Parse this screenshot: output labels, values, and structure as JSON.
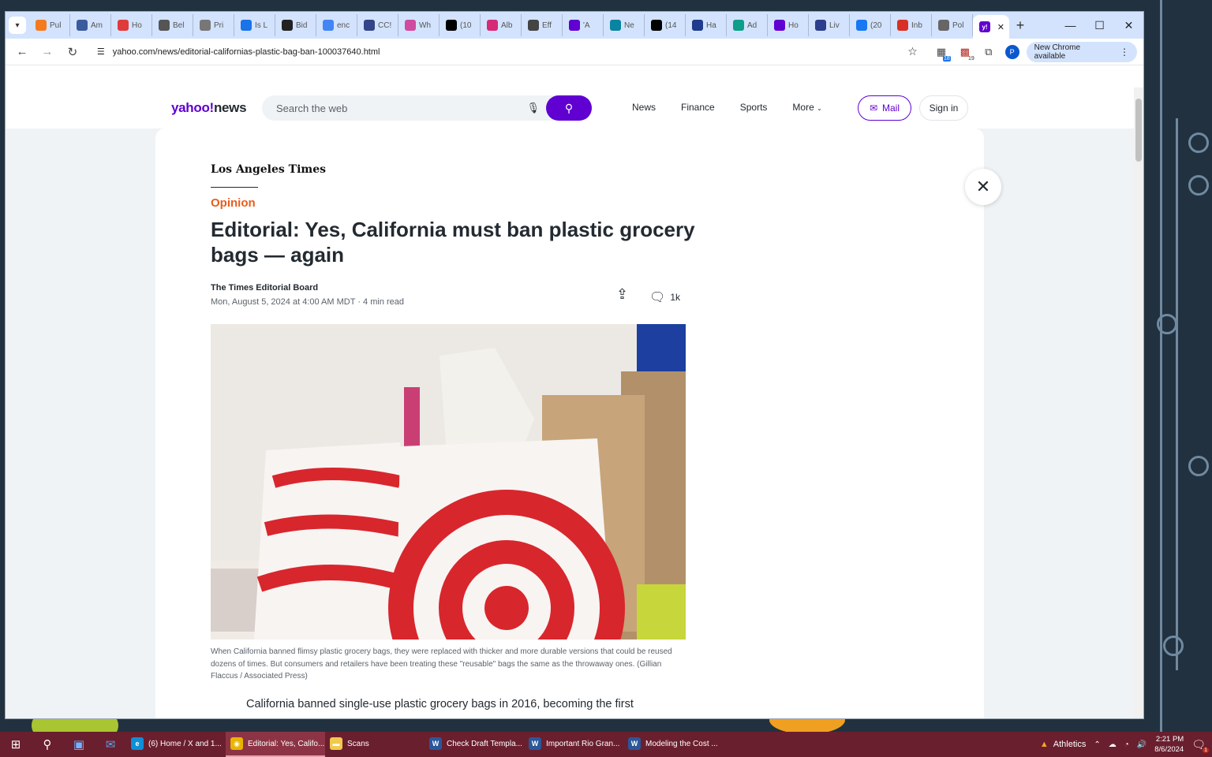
{
  "browser": {
    "tabs": [
      {
        "label": "Pul",
        "icon": "puzzle-orange-icon",
        "color": "#f47a20"
      },
      {
        "label": "Am",
        "icon": "globe-icon",
        "color": "#3a5b9c"
      },
      {
        "label": "Ho",
        "icon": "pen-icon",
        "color": "#e03a3a"
      },
      {
        "label": "Bel",
        "icon": "seal-icon",
        "color": "#555555"
      },
      {
        "label": "Pri",
        "icon": "seal-icon",
        "color": "#777777"
      },
      {
        "label": "Is L",
        "icon": "b-icon",
        "color": "#1a73e8"
      },
      {
        "label": "Bid",
        "icon": "diamond-icon",
        "color": "#222222"
      },
      {
        "label": "enc",
        "icon": "google-icon",
        "color": "#4285f4"
      },
      {
        "label": "CC!",
        "icon": "seal-icon",
        "color": "#334488"
      },
      {
        "label": "Wh",
        "icon": "wave-icon",
        "color": "#d04aa0"
      },
      {
        "label": "(10",
        "icon": "x-icon",
        "color": "#000000"
      },
      {
        "label": "Alb",
        "icon": "instagram-icon",
        "color": "#d62976"
      },
      {
        "label": "Eff",
        "icon": "seal-icon",
        "color": "#444444"
      },
      {
        "label": "'A",
        "icon": "yahoo-icon",
        "color": "#6001d2"
      },
      {
        "label": "Ne",
        "icon": "globe-icon",
        "color": "#0a84a0"
      },
      {
        "label": "(14",
        "icon": "x-icon",
        "color": "#000000"
      },
      {
        "label": "Ha",
        "icon": "h-icon",
        "color": "#1f3b8c"
      },
      {
        "label": "Ad",
        "icon": "r-icon",
        "color": "#0e9e8a"
      },
      {
        "label": "Ho",
        "icon": "yahoo-icon",
        "color": "#6001d2"
      },
      {
        "label": "Liv",
        "icon": "seal-icon",
        "color": "#2d3e8c"
      },
      {
        "label": "(20",
        "icon": "facebook-icon",
        "color": "#1877f2"
      },
      {
        "label": "Inb",
        "icon": "gmail-icon",
        "color": "#d93025"
      },
      {
        "label": "Pol",
        "icon": "globe-icon",
        "color": "#666666"
      }
    ],
    "active_tab_icon": "yahoo-icon",
    "url": "yahoo.com/news/editorial-californias-plastic-bag-ban-100037640.html",
    "ext_badge_1": "18",
    "ext_badge_2": "19",
    "profile_initial": "P",
    "update_label": "New Chrome available"
  },
  "yahoo_header": {
    "logo_brand": "yahoo!",
    "logo_section": "news",
    "search_placeholder": "Search the web",
    "nav": [
      "News",
      "Finance",
      "Sports",
      "More"
    ],
    "mail_label": "Mail",
    "signin_label": "Sign in"
  },
  "article": {
    "publisher": "Los Angeles Times",
    "kicker": "Opinion",
    "headline": "Editorial: Yes, California must ban plastic grocery bags — again",
    "author": "The Times Editorial Board",
    "date": "Mon, August 5, 2024 at 4:00 AM MDT",
    "read_time": "4 min read",
    "comment_count": "1k",
    "caption": "When California banned flimsy plastic grocery bags, they were replaced with thicker and more durable versions that could be reused dozens of times. But consumers and retailers have been treating these \"reusable\" bags the same as the throwaway ones. (Gillian Flaccus / Associated Press)",
    "body_first_line": "California banned single-use plastic grocery bags in 2016, becoming the first"
  },
  "taskbar": {
    "apps": [
      {
        "label": "(6) Home / X and 1...",
        "icon": "edge-icon",
        "active": false
      },
      {
        "label": "Editorial: Yes, Califo...",
        "icon": "chrome-icon",
        "active": true
      },
      {
        "label": "Scans",
        "icon": "folder-icon",
        "active": false
      },
      {
        "label": "Check Draft Templa...",
        "icon": "word-icon",
        "active": false
      },
      {
        "label": "Important Rio Gran...",
        "icon": "word-icon",
        "active": false
      },
      {
        "label": "Modeling the Cost ...",
        "icon": "word-icon",
        "active": false
      }
    ],
    "weather_label": "Athletics",
    "time": "2:21 PM",
    "date": "8/6/2024",
    "notification_count": "1"
  }
}
